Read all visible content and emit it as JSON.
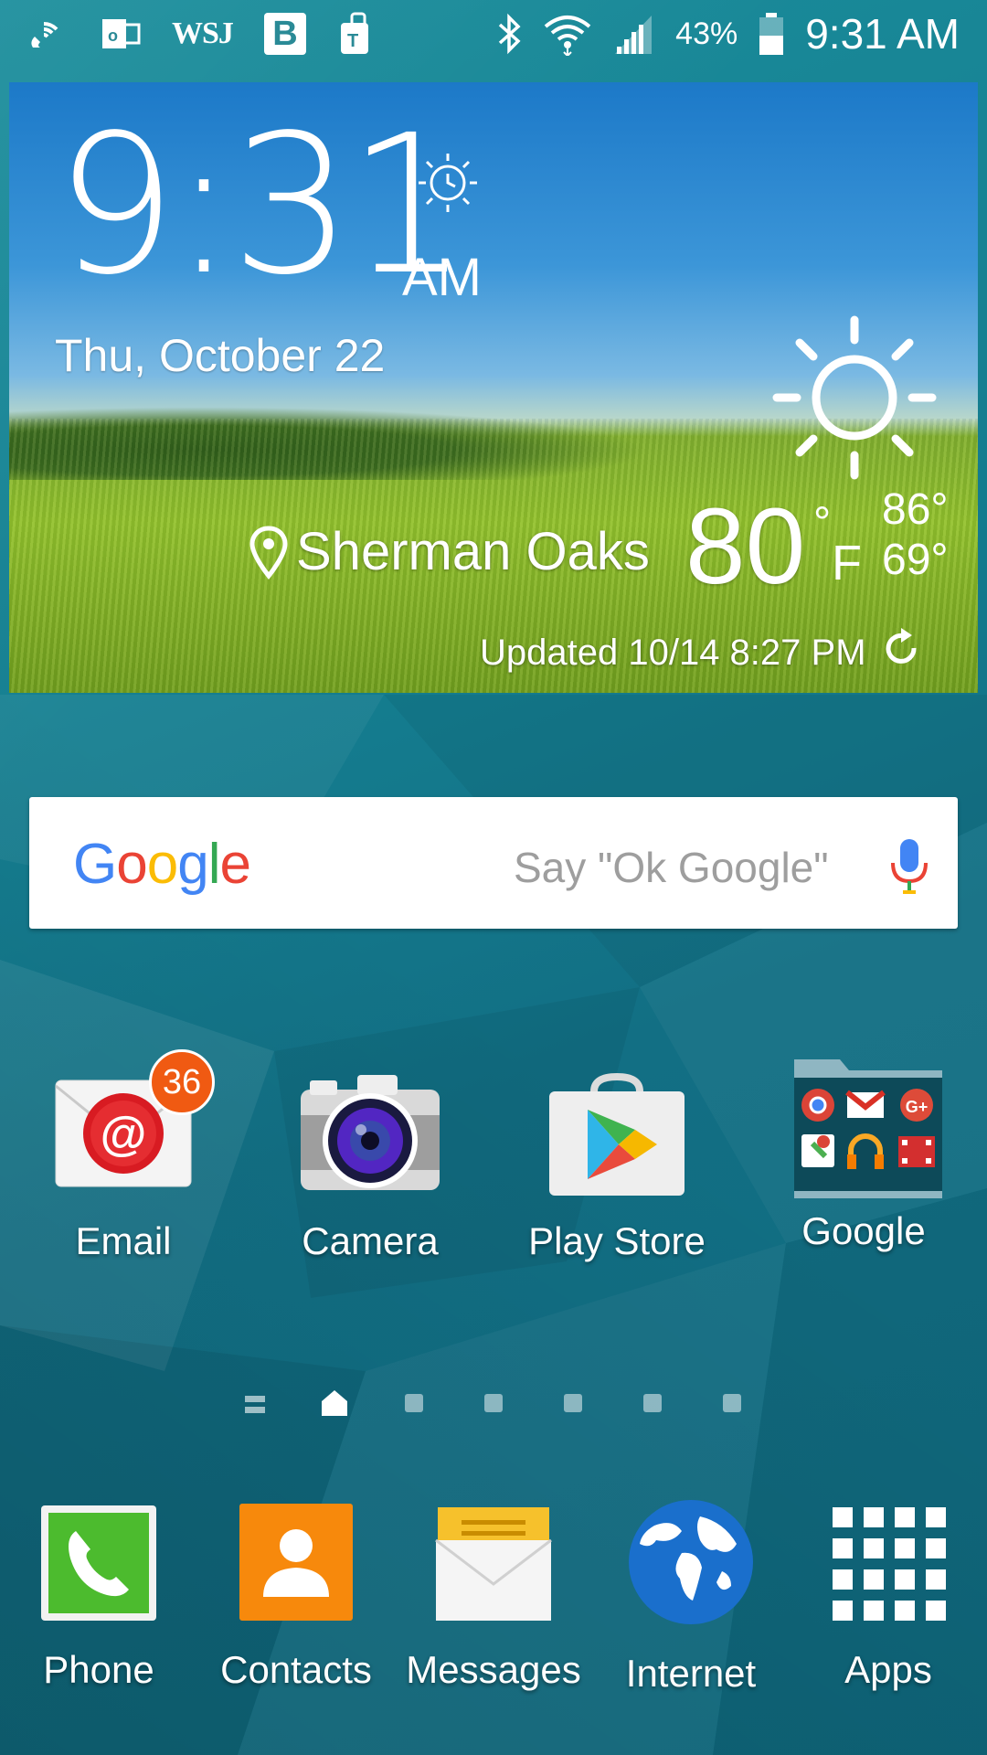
{
  "status_bar": {
    "left_icons": [
      "wifi-calling-icon",
      "outlook-icon",
      "wsj-icon",
      "b-icon",
      "tmobile-icon"
    ],
    "wsj_text": "WSJ",
    "b_text": "B",
    "battery_percent": "43%",
    "time": "9:31 AM",
    "right_icons": [
      "bluetooth-icon",
      "wifi-icon",
      "signal-icon",
      "battery-icon"
    ]
  },
  "weather_widget": {
    "time": "9:31",
    "ampm": "AM",
    "date": "Thu, October 22",
    "location": "Sherman Oaks",
    "temperature": "80",
    "degree": "°",
    "unit": "F",
    "high": "86°",
    "low": "69°",
    "updated": "Updated 10/14 8:27 PM",
    "condition_icon": "sun-icon"
  },
  "google_search": {
    "logo": [
      "G",
      "o",
      "o",
      "g",
      "l",
      "e"
    ],
    "logo_colors": [
      "#4285F4",
      "#EA4335",
      "#FBBC05",
      "#4285F4",
      "#34A853",
      "#EA4335"
    ],
    "hint": "Say \"Ok Google\""
  },
  "home_apps": [
    {
      "label": "Email",
      "badge": "36"
    },
    {
      "label": "Camera"
    },
    {
      "label": "Play Store"
    },
    {
      "label": "Google"
    }
  ],
  "pager": {
    "pages": 7,
    "current": 1
  },
  "dock": [
    {
      "label": "Phone"
    },
    {
      "label": "Contacts"
    },
    {
      "label": "Messages"
    },
    {
      "label": "Internet"
    },
    {
      "label": "Apps"
    }
  ],
  "colors": {
    "wallpaper": "#157f91",
    "badge": "#f05a12",
    "phone": "#4cbb2e",
    "contacts": "#f7890c",
    "messages": "#f6c12c",
    "internet": "#1a6fcc"
  }
}
